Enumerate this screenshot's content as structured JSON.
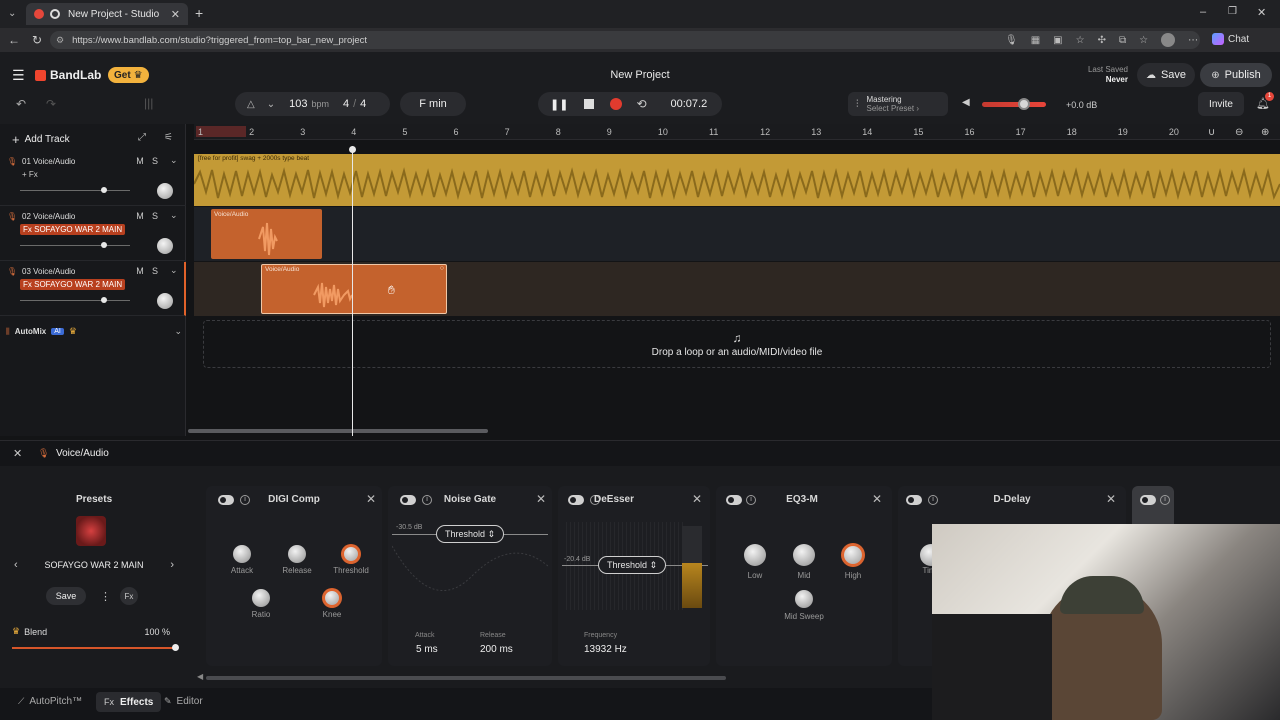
{
  "browser": {
    "tab_title": "New Project - Studio",
    "url": "https://www.bandlab.com/studio?triggered_from=top_bar_new_project",
    "chat_label": "Chat"
  },
  "header": {
    "brand": "BandLab",
    "get_label": "Get",
    "project_title": "New Project",
    "last_saved_label": "Last Saved",
    "last_saved_value": "Never",
    "save_label": "Save",
    "publish_label": "Publish",
    "bpm": "103",
    "bpm_unit": "bpm",
    "time_sig_num": "4",
    "time_sig_den": "4",
    "key": "F min",
    "time": "00:07.2",
    "mastering_title": "Mastering",
    "mastering_preset": "Select Preset",
    "volume_db": "+0.0 dB",
    "invite_label": "Invite",
    "notif_count": "1"
  },
  "tracklist": {
    "add_track": "Add Track",
    "tracks": [
      {
        "name": "01  Voice/Audio",
        "fx": "+ Fx",
        "fx_preset": false
      },
      {
        "name": "02  Voice/Audio",
        "fx": "Fx  SOFAYGO WAR 2 MAIN",
        "fx_preset": true
      },
      {
        "name": "03  Voice/Audio",
        "fx": "Fx  SOFAYGO WAR 2 MAIN",
        "fx_preset": true
      }
    ],
    "m_label": "M",
    "s_label": "S",
    "automix": "AutoMix",
    "ai_badge": "AI"
  },
  "timeline": {
    "ruler": [
      "1",
      "2",
      "3",
      "4",
      "5",
      "6",
      "7",
      "8",
      "9",
      "10",
      "11",
      "12",
      "13",
      "14",
      "15",
      "16",
      "17",
      "18",
      "19",
      "20"
    ],
    "clip1_label": "[free for profit] swag + 2000s type beat",
    "clip2_label": "Voice/Audio",
    "clip3_label": "Voice/Audio",
    "drop_text": "Drop a loop or an audio/MIDI/video file"
  },
  "fx": {
    "panel_title": "Voice/Audio",
    "presets_label": "Presets",
    "preset_name": "SOFAYGO WAR 2 MAIN",
    "save_label": "Save",
    "fx_icon_label": "Fx",
    "blend_label": "Blend",
    "blend_value": "100 %",
    "blend_fraction": 1.0,
    "cards": {
      "digi": {
        "title": "DIGI Comp",
        "attack": "Attack",
        "release": "Release",
        "threshold": "Threshold",
        "ratio": "Ratio",
        "knee": "Knee"
      },
      "gate": {
        "title": "Noise Gate",
        "threshold": "Threshold",
        "db": "-30.5 dB",
        "attack_label": "Attack",
        "attack_value": "5 ms",
        "release_label": "Release",
        "release_value": "200 ms"
      },
      "deesser": {
        "title": "DeEsser",
        "threshold": "Threshold",
        "db": "-20.4 dB",
        "freq_label": "Frequency",
        "freq_value": "13932 Hz"
      },
      "eq": {
        "title": "EQ3-M",
        "low": "Low",
        "mid": "Mid",
        "high": "High",
        "sweep": "Mid Sweep"
      },
      "delay": {
        "title": "D-Delay",
        "time": "Tim"
      }
    }
  },
  "bottom": {
    "autopitch": "AutoPitch™",
    "effects_icon": "Fx",
    "effects": "Effects",
    "editor": "Editor"
  }
}
